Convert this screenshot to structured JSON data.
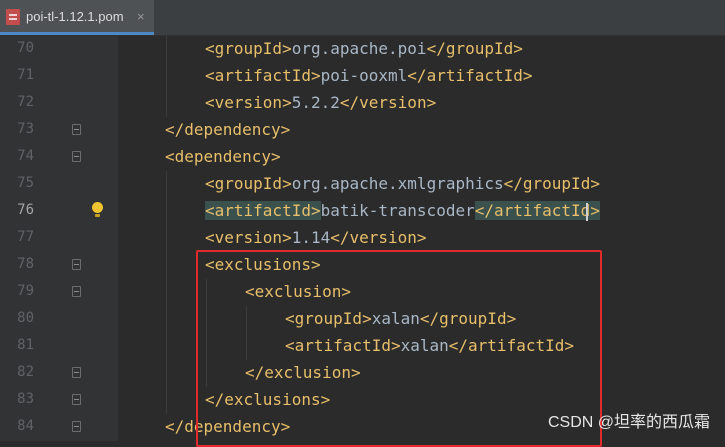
{
  "tab": {
    "icon": "maven-pom-file-icon",
    "title": "poi-tl-1.12.1.pom",
    "close": "×"
  },
  "lines": [
    {
      "num": "70",
      "open": "<groupId>",
      "text": "org.apache.poi",
      "close": "</groupId>"
    },
    {
      "num": "71",
      "open": "<artifactId>",
      "text": "poi-ooxml",
      "close": "</artifactId>"
    },
    {
      "num": "72",
      "open": "<version>",
      "text": "5.2.2",
      "close": "</version>"
    },
    {
      "num": "73",
      "open": "</dependency>"
    },
    {
      "num": "74",
      "open": "<dependency>"
    },
    {
      "num": "75",
      "open": "<groupId>",
      "text": "org.apache.xmlgraphics",
      "close": "</groupId>"
    },
    {
      "num": "76",
      "open": "<artifactId>",
      "text": "batik-transcoder",
      "close": "</artifactId>"
    },
    {
      "num": "77",
      "open": "<version>",
      "text": "1.14",
      "close": "</version>"
    },
    {
      "num": "78",
      "open": "<exclusions>"
    },
    {
      "num": "79",
      "open": "<exclusion>"
    },
    {
      "num": "80",
      "open": "<groupId>",
      "text": "xalan",
      "close": "</groupId>"
    },
    {
      "num": "81",
      "open": "<artifactId>",
      "text": "xalan",
      "close": "</artifactId>"
    },
    {
      "num": "82",
      "open": "</exclusion>"
    },
    {
      "num": "83",
      "open": "</exclusions>"
    },
    {
      "num": "84",
      "open": "</dependency>"
    }
  ],
  "watermark": "CSDN @坦率的西瓜霜",
  "colors": {
    "tag": "#e8bf6a",
    "text": "#a9b7c6",
    "highlight": "#e12a2a",
    "line_number": "#606366"
  }
}
